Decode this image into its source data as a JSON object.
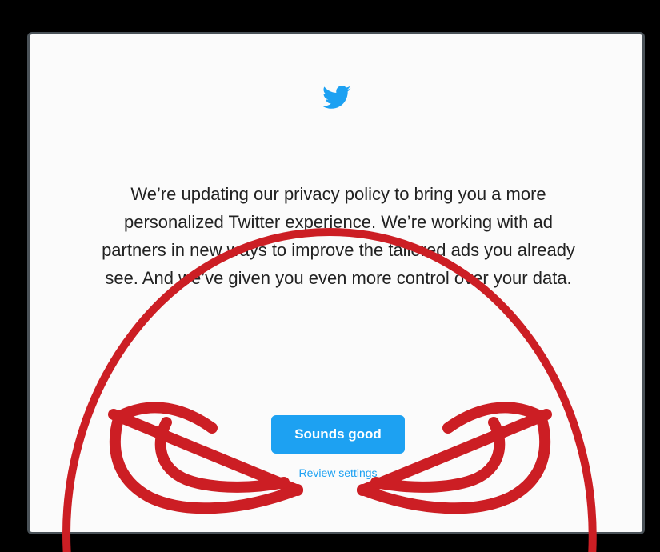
{
  "dialog": {
    "logo_icon": "twitter-bird-icon",
    "message": "We’re updating our privacy policy to bring you a more personalized Twitter experience. We’re working with ad partners in new ways to improve the tailored ads you already see. And we’ve given you even more control over your data.",
    "primary_button_label": "Sounds good",
    "secondary_link_label": "Review settings"
  },
  "overlay": {
    "drawing": "angry-eyes-face",
    "color": "#cc1e24"
  },
  "colors": {
    "background": "#000000",
    "dialog_background": "#fbfbfb",
    "dialog_border": "#4a5258",
    "twitter_blue": "#1da1f2",
    "text": "#222222"
  }
}
